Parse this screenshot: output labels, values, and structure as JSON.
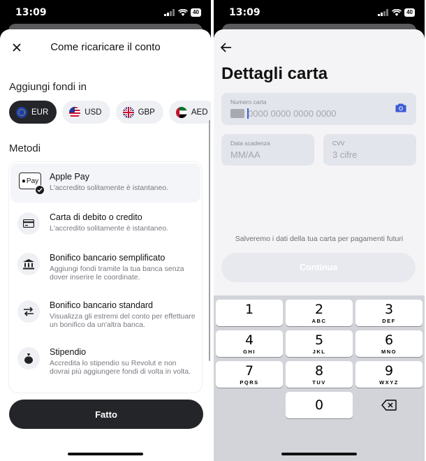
{
  "status": {
    "time_left": "13:09",
    "time_right": "13:09",
    "battery": "40"
  },
  "left": {
    "title": "Come ricaricare il conto",
    "funds_label": "Aggiungi fondi in",
    "currencies": [
      {
        "code": "EUR",
        "active": true
      },
      {
        "code": "USD",
        "active": false
      },
      {
        "code": "GBP",
        "active": false
      },
      {
        "code": "AED",
        "active": false
      }
    ],
    "methods_label": "Metodi",
    "apple_pay_mark": "Pay",
    "methods": [
      {
        "name": "Apple Pay",
        "desc": "L'accredito solitamente è istantaneo.",
        "icon": "apple-pay-icon",
        "selected": true
      },
      {
        "name": "Carta di debito o credito",
        "desc": "L'accredito solitamente è istantaneo.",
        "icon": "card-icon"
      },
      {
        "name": "Bonifico bancario semplificato",
        "desc": "Aggiungi fondi tramite la tua banca senza dover inserire le coordinate.",
        "icon": "bank-icon"
      },
      {
        "name": "Bonifico bancario standard",
        "desc": "Visualizza gli estremi del conto per effettuare un bonifico da un'altra banca.",
        "icon": "transfer-arrows-icon"
      },
      {
        "name": "Stipendio",
        "desc": "Accredita lo stipendio su Revolut e non dovrai più aggiungere fondi di volta in volta.",
        "icon": "money-bag-icon"
      }
    ],
    "done_label": "Fatto"
  },
  "right": {
    "title": "Dettagli carta",
    "card_number": {
      "label": "Numero carta",
      "placeholder": "0000 0000 0000 0000"
    },
    "expiry": {
      "label": "Data scadenza",
      "placeholder": "MM/AA"
    },
    "cvv": {
      "label": "CVV",
      "placeholder": "3 cifre"
    },
    "save_note": "Salveremo i dati della tua carta per pagamenti futuri",
    "continue_label": "Continua",
    "keypad": [
      {
        "digit": "1",
        "letters": ""
      },
      {
        "digit": "2",
        "letters": "ABC"
      },
      {
        "digit": "3",
        "letters": "DEF"
      },
      {
        "digit": "4",
        "letters": "GHI"
      },
      {
        "digit": "5",
        "letters": "JKL"
      },
      {
        "digit": "6",
        "letters": "MNO"
      },
      {
        "digit": "7",
        "letters": "PQRS"
      },
      {
        "digit": "8",
        "letters": "TUV"
      },
      {
        "digit": "9",
        "letters": "WXYZ"
      },
      {
        "digit": "0",
        "letters": ""
      }
    ]
  },
  "colors": {
    "dark_button": "#232528",
    "chip_bg": "#eef0f4",
    "field_bg": "#e3e5ec",
    "accent_blue": "#3b5bd6"
  }
}
